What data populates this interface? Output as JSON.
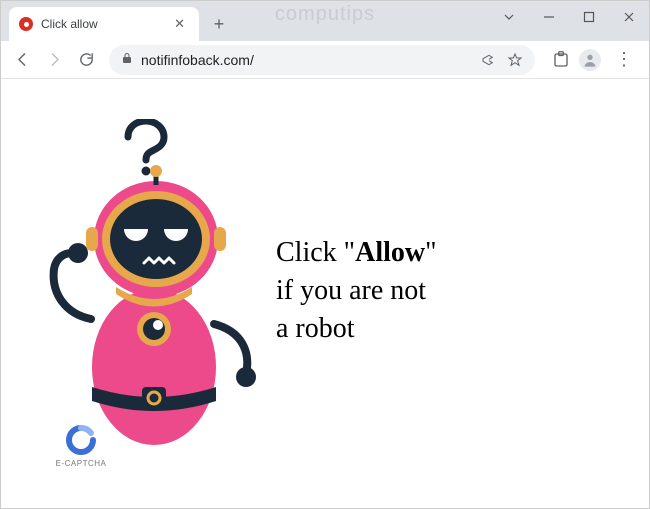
{
  "window": {
    "watermark": "computips"
  },
  "tab": {
    "title": "Click allow"
  },
  "toolbar": {
    "url": "notifinfoback.com/"
  },
  "page": {
    "msg_prefix": "Click \"",
    "msg_bold": "Allow",
    "msg_suffix": "\"",
    "msg_line2": "if you are not",
    "msg_line3": "a robot",
    "captcha_label": "E-CAPTCHA"
  }
}
